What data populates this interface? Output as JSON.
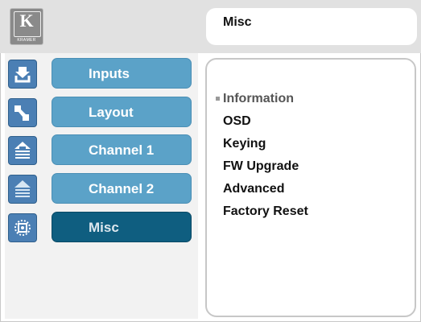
{
  "header": {
    "logo": {
      "letter": "K",
      "brand": "KRAMER",
      "icon": "kramer-logo-icon"
    },
    "title": "Misc"
  },
  "sidebar": {
    "items": [
      {
        "label": "Inputs",
        "icon": "inputs-icon",
        "active": false
      },
      {
        "label": "Layout",
        "icon": "layout-icon",
        "active": false
      },
      {
        "label": "Channel 1",
        "icon": "channel-1-icon",
        "active": false
      },
      {
        "label": "Channel 2",
        "icon": "channel-2-icon",
        "active": false
      },
      {
        "label": "Misc",
        "icon": "misc-icon",
        "active": true
      }
    ],
    "ghost_label": "Misc"
  },
  "menu": {
    "items": [
      {
        "label": "Information",
        "selected": true
      },
      {
        "label": "OSD",
        "selected": false
      },
      {
        "label": "Keying",
        "selected": false
      },
      {
        "label": "FW Upgrade",
        "selected": false
      },
      {
        "label": "Advanced",
        "selected": false
      },
      {
        "label": "Factory Reset",
        "selected": false
      }
    ]
  },
  "colors": {
    "nav_button": "#5ba2c8",
    "nav_button_active": "#0f5e80",
    "nav_icon": "#4b7fb4",
    "topbar": "#e1e1e1"
  }
}
